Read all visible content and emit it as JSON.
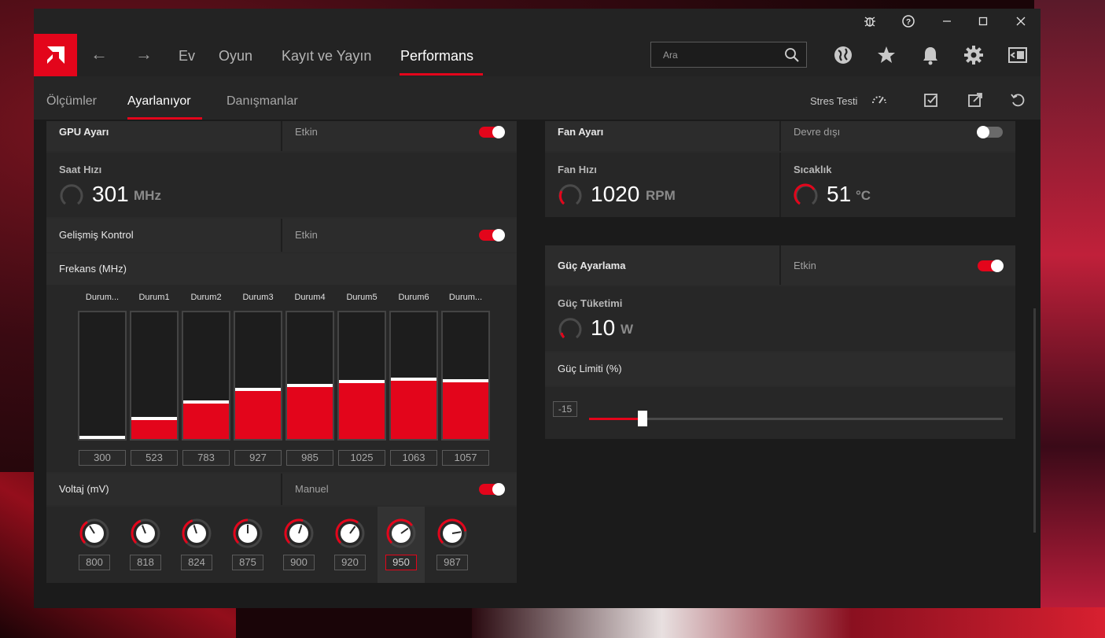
{
  "titlebar": {
    "icons": [
      "bug-icon",
      "help-icon",
      "minimize-icon",
      "maximize-icon",
      "close-icon"
    ]
  },
  "nav": {
    "items": [
      {
        "label": "Ev",
        "active": false
      },
      {
        "label": "Oyun",
        "active": false
      },
      {
        "label": "Kayıt ve Yayın",
        "active": false
      },
      {
        "label": "Performans",
        "active": true
      }
    ],
    "search_placeholder": "Ara",
    "accent_color": "#e3051b"
  },
  "subnav": {
    "items": [
      {
        "label": "Ölçümler",
        "active": false
      },
      {
        "label": "Ayarlanıyor",
        "active": true
      },
      {
        "label": "Danışmanlar",
        "active": false
      }
    ],
    "stress_test": "Stres Testi"
  },
  "gpu": {
    "title": "GPU Ayarı",
    "status": "Etkin",
    "enabled": true,
    "clock_label": "Saat Hızı",
    "clock_value": "301",
    "clock_unit": "MHz",
    "advanced_label": "Gelişmiş Kontrol",
    "advanced_status": "Etkin",
    "advanced_enabled": true,
    "freq_label": "Frekans (MHz)",
    "states": [
      {
        "name": "Durum...",
        "freq": "300",
        "fill": 0.0,
        "voltage": "800",
        "knob": 0.57
      },
      {
        "name": "Durum1",
        "freq": "523",
        "fill": 0.15,
        "voltage": "818",
        "knob": 0.63
      },
      {
        "name": "Durum2",
        "freq": "783",
        "fill": 0.28,
        "voltage": "824",
        "knob": 0.65
      },
      {
        "name": "Durum3",
        "freq": "927",
        "fill": 0.38,
        "voltage": "875",
        "knob": 0.75
      },
      {
        "name": "Durum4",
        "freq": "985",
        "fill": 0.41,
        "voltage": "900",
        "knob": 0.85
      },
      {
        "name": "Durum5",
        "freq": "1025",
        "fill": 0.44,
        "voltage": "920",
        "knob": 0.95
      },
      {
        "name": "Durum6",
        "freq": "1063",
        "fill": 0.46,
        "voltage": "950",
        "knob": 1.05
      },
      {
        "name": "Durum...",
        "freq": "1057",
        "fill": 0.45,
        "voltage": "987",
        "knob": 1.2
      }
    ],
    "voltage_label": "Voltaj (mV)",
    "voltage_mode": "Manuel",
    "voltage_enabled": true,
    "selected_state": 6
  },
  "fan": {
    "title": "Fan Ayarı",
    "status": "Devre dışı",
    "enabled": false,
    "speed_label": "Fan Hızı",
    "speed_value": "1020",
    "speed_unit": "RPM",
    "temp_label": "Sıcaklık",
    "temp_value": "51",
    "temp_unit": "°C"
  },
  "power": {
    "title": "Güç Ayarlama",
    "status": "Etkin",
    "enabled": true,
    "consumption_label": "Güç Tüketimi",
    "consumption_value": "10",
    "consumption_unit": "W",
    "limit_label": "Güç Limiti (%)",
    "limit_value": "-15",
    "limit_fraction": 0.13
  }
}
